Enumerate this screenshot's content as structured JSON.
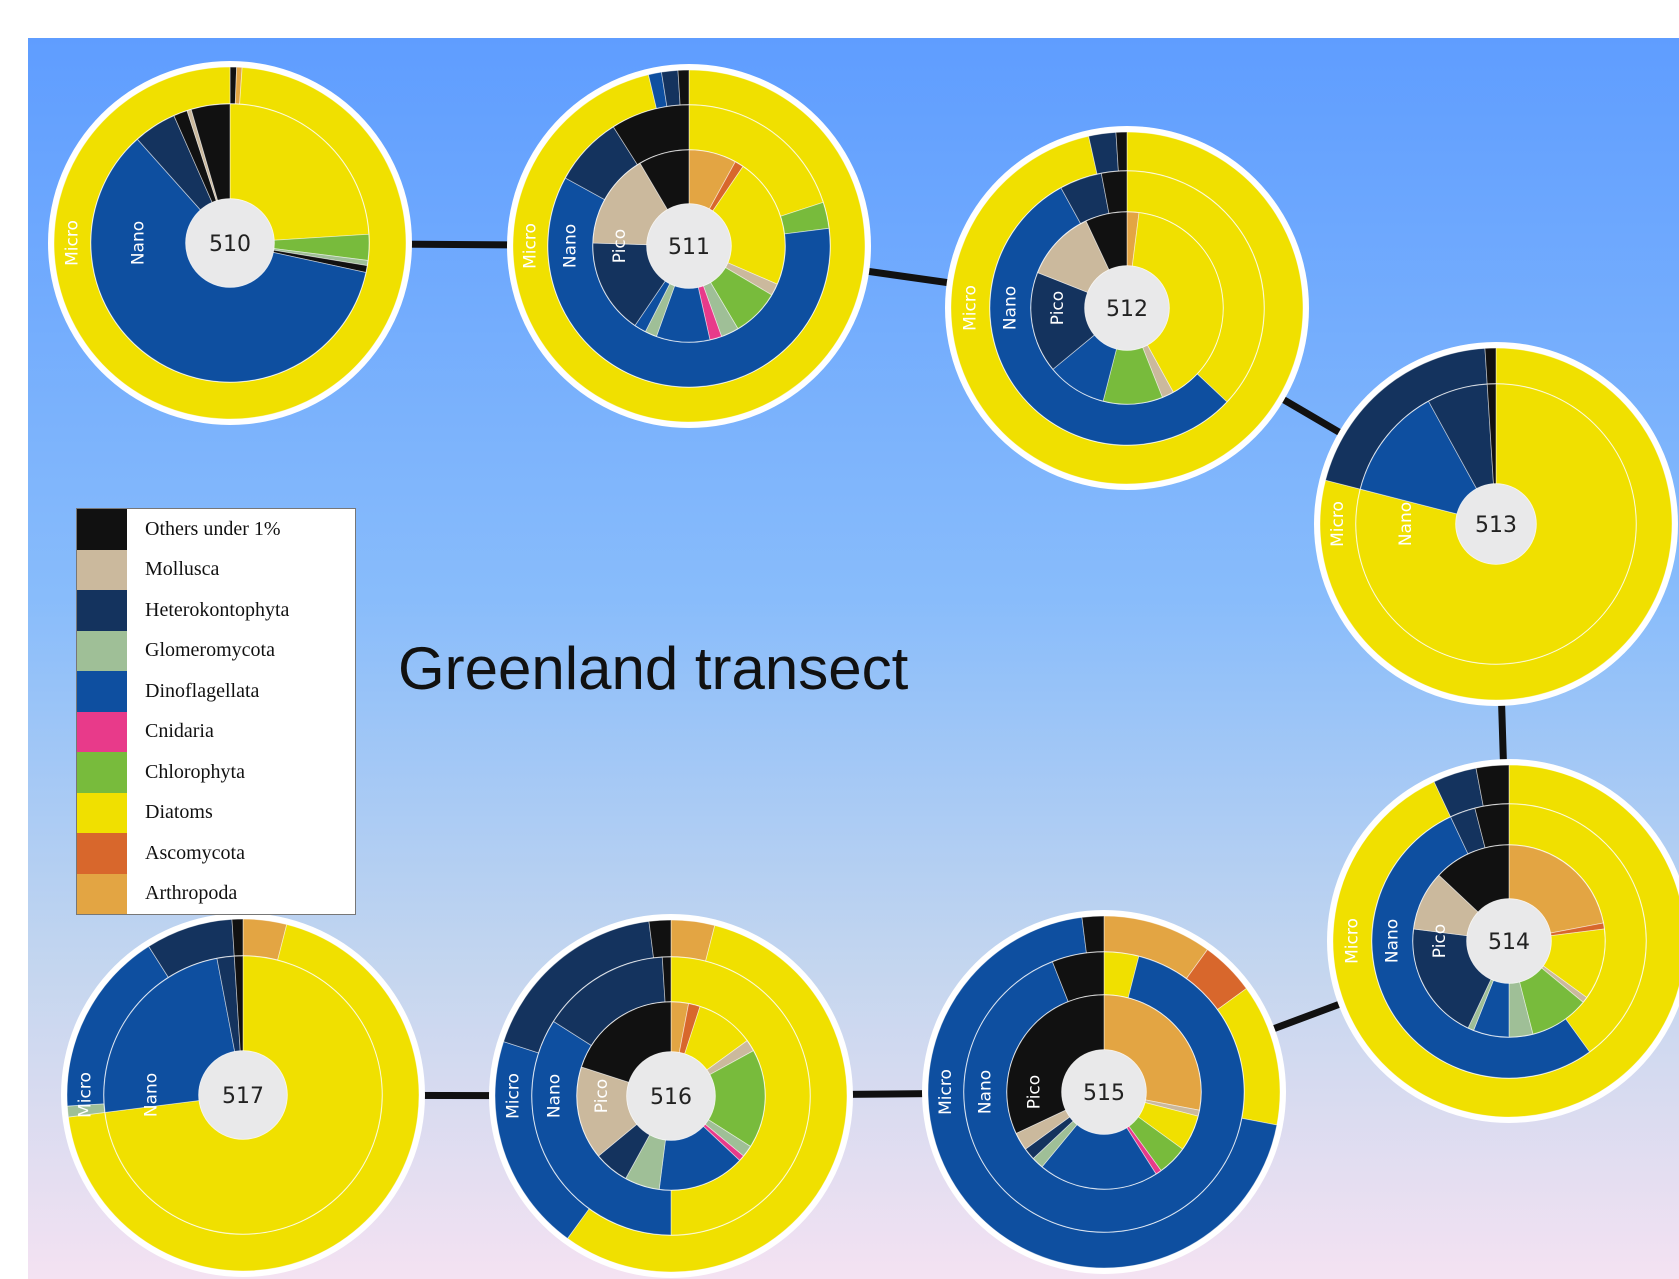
{
  "chart_data": {
    "type": "pie",
    "title": "Greenland transect",
    "legend": {
      "placement": "left",
      "entries": [
        {
          "name": "Others under 1%",
          "color": "#111111"
        },
        {
          "name": "Mollusca",
          "color": "#cbb99d"
        },
        {
          "name": "Heterokontophyta",
          "color": "#14335e"
        },
        {
          "name": "Glomeromycota",
          "color": "#9fbf97"
        },
        {
          "name": "Dinoflagellata",
          "color": "#0e4fa0"
        },
        {
          "name": "Cnidaria",
          "color": "#e83a8a"
        },
        {
          "name": "Chlorophyta",
          "color": "#78bb3c"
        },
        {
          "name": "Diatoms",
          "color": "#f0e000"
        },
        {
          "name": "Ascomycota",
          "color": "#d8672c"
        },
        {
          "name": "Arthropoda",
          "color": "#e3a543"
        }
      ]
    },
    "ring_labels": {
      "micro": "Micro",
      "nano": "Nano",
      "pico": "Pico"
    },
    "stations": [
      {
        "name": "510",
        "rings": {
          "micro": [
            {
              "taxon": "Others under 1%",
              "value": 0.6
            },
            {
              "taxon": "Arthropoda",
              "value": 0.5
            },
            {
              "taxon": "Diatoms",
              "value": 98.9
            }
          ],
          "nano": [
            {
              "taxon": "Diatoms",
              "value": 24
            },
            {
              "taxon": "Chlorophyta",
              "value": 3
            },
            {
              "taxon": "Glomeromycota",
              "value": 0.6
            },
            {
              "taxon": "Others under 1%",
              "value": 0.8
            },
            {
              "taxon": "Dinoflagellata",
              "value": 60
            },
            {
              "taxon": "Heterokontophyta",
              "value": 5
            },
            {
              "taxon": "Others under 1%",
              "value": 1.6
            },
            {
              "taxon": "Mollusca",
              "value": 0.5
            },
            {
              "taxon": "Others under 1%",
              "value": 4.5
            }
          ]
        }
      },
      {
        "name": "511",
        "rings": {
          "micro": [
            {
              "taxon": "Diatoms",
              "value": 96.3
            },
            {
              "taxon": "Dinoflagellata",
              "value": 1.2
            },
            {
              "taxon": "Heterokontophyta",
              "value": 1.5
            },
            {
              "taxon": "Others under 1%",
              "value": 1
            }
          ],
          "nano": [
            {
              "taxon": "Diatoms",
              "value": 20
            },
            {
              "taxon": "Chlorophyta",
              "value": 3
            },
            {
              "taxon": "Dinoflagellata",
              "value": 60
            },
            {
              "taxon": "Heterokontophyta",
              "value": 8
            },
            {
              "taxon": "Others under 1%",
              "value": 9
            }
          ],
          "pico": [
            {
              "taxon": "Arthropoda",
              "value": 8
            },
            {
              "taxon": "Ascomycota",
              "value": 1.5
            },
            {
              "taxon": "Diatoms",
              "value": 22
            },
            {
              "taxon": "Mollusca",
              "value": 2
            },
            {
              "taxon": "Chlorophyta",
              "value": 8
            },
            {
              "taxon": "Glomeromycota",
              "value": 3
            },
            {
              "taxon": "Cnidaria",
              "value": 2
            },
            {
              "taxon": "Dinoflagellata",
              "value": 9
            },
            {
              "taxon": "Glomeromycota",
              "value": 2
            },
            {
              "taxon": "Dinoflagellata",
              "value": 2
            },
            {
              "taxon": "Heterokontophyta",
              "value": 16
            },
            {
              "taxon": "Mollusca",
              "value": 16
            },
            {
              "taxon": "Others under 1%",
              "value": 8.5
            }
          ]
        }
      },
      {
        "name": "512",
        "rings": {
          "micro": [
            {
              "taxon": "Diatoms",
              "value": 96.5
            },
            {
              "taxon": "Heterokontophyta",
              "value": 2.5
            },
            {
              "taxon": "Others under 1%",
              "value": 1
            }
          ],
          "nano": [
            {
              "taxon": "Diatoms",
              "value": 37
            },
            {
              "taxon": "Dinoflagellata",
              "value": 55
            },
            {
              "taxon": "Heterokontophyta",
              "value": 5
            },
            {
              "taxon": "Others under 1%",
              "value": 3
            }
          ],
          "pico": [
            {
              "taxon": "Arthropoda",
              "value": 2
            },
            {
              "taxon": "Diatoms",
              "value": 40
            },
            {
              "taxon": "Mollusca",
              "value": 2
            },
            {
              "taxon": "Chlorophyta",
              "value": 10
            },
            {
              "taxon": "Dinoflagellata",
              "value": 10
            },
            {
              "taxon": "Heterokontophyta",
              "value": 17
            },
            {
              "taxon": "Mollusca",
              "value": 12
            },
            {
              "taxon": "Others under 1%",
              "value": 7
            }
          ]
        }
      },
      {
        "name": "513",
        "rings": {
          "micro": [
            {
              "taxon": "Diatoms",
              "value": 79
            },
            {
              "taxon": "Heterokontophyta",
              "value": 20
            },
            {
              "taxon": "Others under 1%",
              "value": 1
            }
          ],
          "nano": [
            {
              "taxon": "Diatoms",
              "value": 79
            },
            {
              "taxon": "Dinoflagellata",
              "value": 13
            },
            {
              "taxon": "Heterokontophyta",
              "value": 7
            },
            {
              "taxon": "Others under 1%",
              "value": 1
            }
          ]
        }
      },
      {
        "name": "514",
        "rings": {
          "micro": [
            {
              "taxon": "Diatoms",
              "value": 93
            },
            {
              "taxon": "Heterokontophyta",
              "value": 4
            },
            {
              "taxon": "Others under 1%",
              "value": 3
            }
          ],
          "nano": [
            {
              "taxon": "Diatoms",
              "value": 40
            },
            {
              "taxon": "Dinoflagellata",
              "value": 53
            },
            {
              "taxon": "Heterokontophyta",
              "value": 3
            },
            {
              "taxon": "Others under 1%",
              "value": 4
            }
          ],
          "pico": [
            {
              "taxon": "Arthropoda",
              "value": 22
            },
            {
              "taxon": "Ascomycota",
              "value": 1
            },
            {
              "taxon": "Diatoms",
              "value": 12
            },
            {
              "taxon": "Mollusca",
              "value": 1
            },
            {
              "taxon": "Chlorophyta",
              "value": 10
            },
            {
              "taxon": "Glomeromycota",
              "value": 4
            },
            {
              "taxon": "Dinoflagellata",
              "value": 6
            },
            {
              "taxon": "Glomeromycota",
              "value": 1
            },
            {
              "taxon": "Heterokontophyta",
              "value": 20
            },
            {
              "taxon": "Mollusca",
              "value": 10
            },
            {
              "taxon": "Others under 1%",
              "value": 13
            }
          ]
        }
      },
      {
        "name": "515",
        "rings": {
          "micro": [
            {
              "taxon": "Arthropoda",
              "value": 10
            },
            {
              "taxon": "Ascomycota",
              "value": 5
            },
            {
              "taxon": "Diatoms",
              "value": 13
            },
            {
              "taxon": "Dinoflagellata",
              "value": 70
            },
            {
              "taxon": "Others under 1%",
              "value": 2
            }
          ],
          "nano": [
            {
              "taxon": "Diatoms",
              "value": 4
            },
            {
              "taxon": "Dinoflagellata",
              "value": 90
            },
            {
              "taxon": "Others under 1%",
              "value": 6
            }
          ],
          "pico": [
            {
              "taxon": "Arthropoda",
              "value": 28
            },
            {
              "taxon": "Mollusca",
              "value": 1
            },
            {
              "taxon": "Diatoms",
              "value": 6
            },
            {
              "taxon": "Chlorophyta",
              "value": 5
            },
            {
              "taxon": "Cnidaria",
              "value": 1
            },
            {
              "taxon": "Dinoflagellata",
              "value": 20
            },
            {
              "taxon": "Glomeromycota",
              "value": 2
            },
            {
              "taxon": "Heterokontophyta",
              "value": 2
            },
            {
              "taxon": "Mollusca",
              "value": 3
            },
            {
              "taxon": "Others under 1%",
              "value": 32
            }
          ]
        }
      },
      {
        "name": "516",
        "rings": {
          "micro": [
            {
              "taxon": "Arthropoda",
              "value": 4
            },
            {
              "taxon": "Diatoms",
              "value": 56
            },
            {
              "taxon": "Dinoflagellata",
              "value": 20
            },
            {
              "taxon": "Heterokontophyta",
              "value": 18
            },
            {
              "taxon": "Others under 1%",
              "value": 2
            }
          ],
          "nano": [
            {
              "taxon": "Diatoms",
              "value": 50
            },
            {
              "taxon": "Dinoflagellata",
              "value": 34
            },
            {
              "taxon": "Heterokontophyta",
              "value": 15
            },
            {
              "taxon": "Others under 1%",
              "value": 1
            }
          ],
          "pico": [
            {
              "taxon": "Arthropoda",
              "value": 3
            },
            {
              "taxon": "Ascomycota",
              "value": 2
            },
            {
              "taxon": "Diatoms",
              "value": 10
            },
            {
              "taxon": "Mollusca",
              "value": 2
            },
            {
              "taxon": "Chlorophyta",
              "value": 17
            },
            {
              "taxon": "Glomeromycota",
              "value": 2
            },
            {
              "taxon": "Cnidaria",
              "value": 1
            },
            {
              "taxon": "Dinoflagellata",
              "value": 15
            },
            {
              "taxon": "Glomeromycota",
              "value": 6
            },
            {
              "taxon": "Heterokontophyta",
              "value": 6
            },
            {
              "taxon": "Mollusca",
              "value": 16
            },
            {
              "taxon": "Others under 1%",
              "value": 20
            }
          ]
        }
      },
      {
        "name": "517",
        "rings": {
          "micro": [
            {
              "taxon": "Arthropoda",
              "value": 4
            },
            {
              "taxon": "Diatoms",
              "value": 69
            },
            {
              "taxon": "Glomeromycota",
              "value": 1
            },
            {
              "taxon": "Dinoflagellata",
              "value": 17
            },
            {
              "taxon": "Heterokontophyta",
              "value": 8
            },
            {
              "taxon": "Others under 1%",
              "value": 1
            }
          ],
          "nano": [
            {
              "taxon": "Diatoms",
              "value": 73
            },
            {
              "taxon": "Dinoflagellata",
              "value": 24
            },
            {
              "taxon": "Heterokontophyta",
              "value": 2
            },
            {
              "taxon": "Others under 1%",
              "value": 1
            }
          ]
        }
      }
    ]
  }
}
